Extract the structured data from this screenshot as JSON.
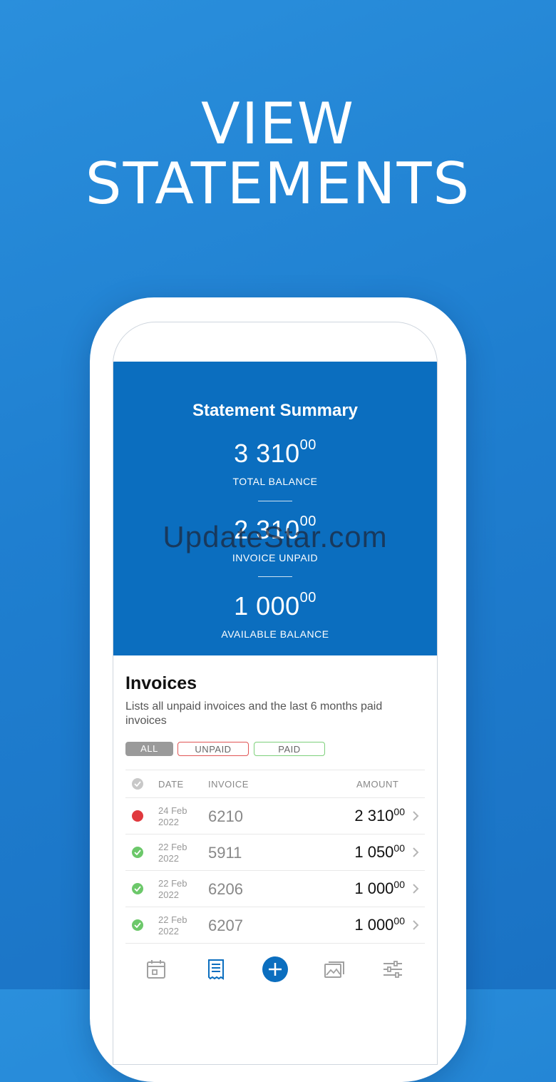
{
  "headline": {
    "line1": "VIEW",
    "line2": "STATEMENTS"
  },
  "watermark": "UpdateStar.com",
  "summary": {
    "title": "Statement Summary",
    "total_balance": {
      "main": "3 310",
      "cents": "00",
      "label": "TOTAL BALANCE"
    },
    "invoice_unpaid": {
      "main": "2 310",
      "cents": "00",
      "label": "INVOICE UNPAID"
    },
    "available_balance": {
      "main": "1 000",
      "cents": "00",
      "label": "AVAILABLE BALANCE"
    }
  },
  "invoices": {
    "title": "Invoices",
    "description": "Lists all unpaid invoices and the last 6 months paid invoices",
    "filters": {
      "all": "ALL",
      "unpaid": "UNPAID",
      "paid": "PAID"
    },
    "columns": {
      "date": "DATE",
      "invoice": "INVOICE",
      "amount": "AMOUNT"
    },
    "rows": [
      {
        "date_day": "24 Feb",
        "date_year": "2022",
        "invoice": "6210",
        "amount_main": "2 310",
        "amount_cents": "00",
        "status": "unpaid"
      },
      {
        "date_day": "22 Feb",
        "date_year": "2022",
        "invoice": "5911",
        "amount_main": "1 050",
        "amount_cents": "00",
        "status": "paid"
      },
      {
        "date_day": "22 Feb",
        "date_year": "2022",
        "invoice": "6206",
        "amount_main": "1 000",
        "amount_cents": "00",
        "status": "paid"
      },
      {
        "date_day": "22 Feb",
        "date_year": "2022",
        "invoice": "6207",
        "amount_main": "1 000",
        "amount_cents": "00",
        "status": "paid"
      }
    ]
  },
  "tabbar": {
    "icons": [
      "calendar-icon",
      "statement-icon",
      "add-icon",
      "gallery-icon",
      "settings-sliders-icon"
    ],
    "active": "statement-icon"
  },
  "colors": {
    "background": "#1f7fd0",
    "summary_bg": "#0b6ebf",
    "unpaid": "#e0393e",
    "paid": "#6cc86a",
    "accent": "#0b6ebf"
  }
}
